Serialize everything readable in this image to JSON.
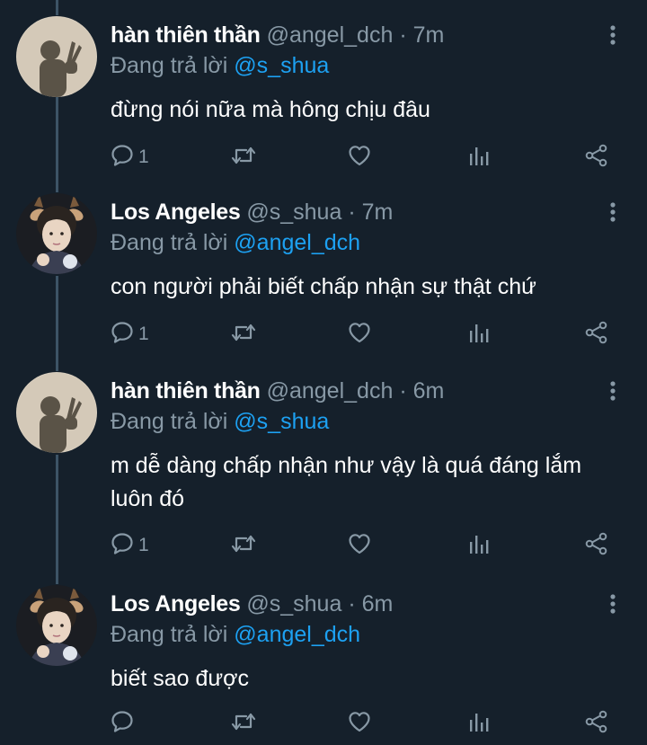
{
  "tweets": [
    {
      "name": "hàn thiên thần",
      "handle": "@angel_dch",
      "dot": "·",
      "time": "7m",
      "reply_prefix": "Đang trả lời",
      "reply_to": "@s_shua",
      "text": "đừng nói nữa mà hông chịu đâu",
      "reply_count": "1",
      "avatar": "shadow-avatar"
    },
    {
      "name": "Los Angeles",
      "handle": "@s_shua",
      "dot": "·",
      "time": "7m",
      "reply_prefix": "Đang trả lời",
      "reply_to": "@angel_dch",
      "text": "con người phải biết chấp nhận sự thật chứ",
      "reply_count": "1",
      "avatar": "deer-ears-avatar"
    },
    {
      "name": "hàn thiên thần",
      "handle": "@angel_dch",
      "dot": "·",
      "time": "6m",
      "reply_prefix": "Đang trả lời",
      "reply_to": "@s_shua",
      "text": "m dễ dàng chấp nhận như vậy là quá đáng lắm luôn đó",
      "reply_count": "1",
      "avatar": "shadow-avatar"
    },
    {
      "name": "Los Angeles",
      "handle": "@s_shua",
      "dot": "·",
      "time": "6m",
      "reply_prefix": "Đang trả lời",
      "reply_to": "@angel_dch",
      "text": "biết sao được",
      "reply_count": "",
      "avatar": "deer-ears-avatar"
    }
  ],
  "icons": {
    "reply": "reply-icon",
    "retweet": "retweet-icon",
    "like": "heart-icon",
    "analytics": "analytics-icon",
    "share": "share-icon",
    "more": "more-vertical-icon"
  },
  "colors": {
    "background": "#15202b",
    "muted": "#8899a6",
    "accent": "#1da1f2",
    "thread_line": "#3d5466"
  }
}
